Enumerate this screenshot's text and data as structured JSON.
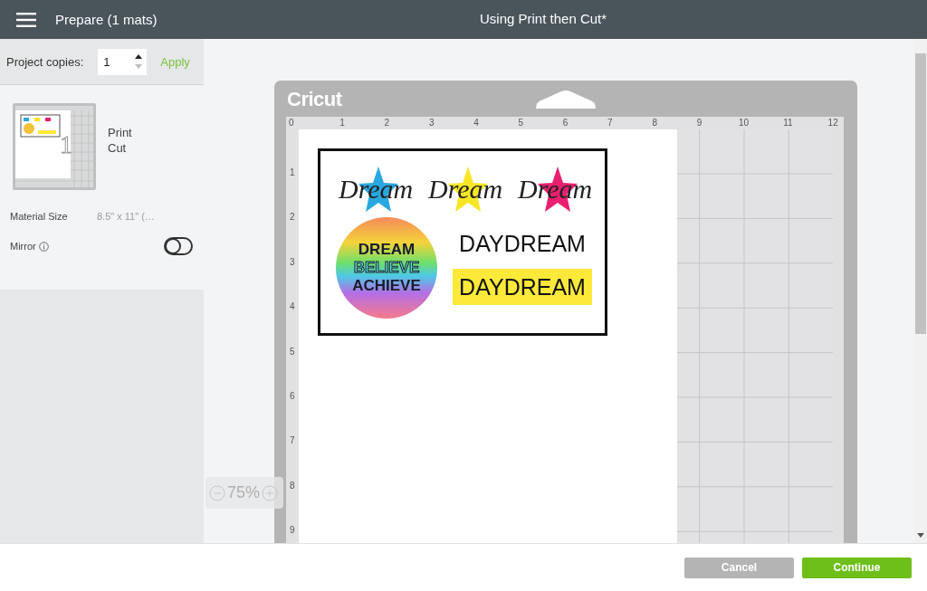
{
  "header": {
    "title": "Prepare (1 mats)",
    "project_title": "Using Print then Cut*"
  },
  "sidebar": {
    "copies_label": "Project copies:",
    "copies_value": "1",
    "apply": "Apply",
    "mats": [
      {
        "number": "1",
        "modes": [
          "Print",
          "Cut"
        ]
      }
    ],
    "material_size": {
      "label": "Material Size",
      "value": "8.5\" x 11\" (…",
      "disabled": true
    },
    "mirror": {
      "label": "Mirror",
      "on": false
    }
  },
  "mat": {
    "logo": "Cricut",
    "x_ruler": [
      "0",
      "1",
      "2",
      "3",
      "4",
      "5",
      "6",
      "7",
      "8",
      "9",
      "10",
      "11",
      "12"
    ],
    "y_ruler": [
      "1",
      "2",
      "3",
      "4",
      "5",
      "6",
      "7",
      "8",
      "9"
    ],
    "design": {
      "stickers": [
        {
          "text": "Dream",
          "color": "#29a8e0"
        },
        {
          "text": "Dream",
          "color": "#f7e627"
        },
        {
          "text": "Dream",
          "color": "#e8206f"
        }
      ],
      "badge": [
        "DREAM",
        "BELIEVE",
        "ACHIEVE"
      ],
      "words": [
        {
          "text": "DAYDREAM",
          "highlighted": false
        },
        {
          "text": "DAYDREAM",
          "highlighted": true
        }
      ]
    }
  },
  "zoom": {
    "level_text": "75%"
  },
  "footer": {
    "buttons": [
      {
        "label": "Cancel",
        "kind": "secondary"
      },
      {
        "label": "Continue",
        "kind": "primary"
      }
    ]
  }
}
